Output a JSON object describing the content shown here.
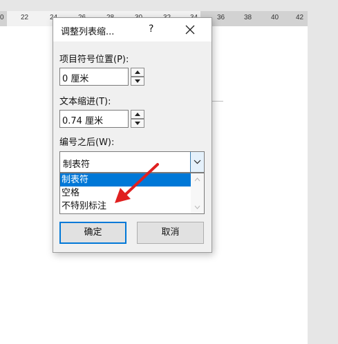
{
  "ruler": {
    "numbers": [
      "0",
      "22",
      "24",
      "26",
      "28",
      "30",
      "32",
      "34",
      "36",
      "38",
      "40",
      "42"
    ]
  },
  "dialog": {
    "title": "调整列表缩...",
    "help_label": "?",
    "position_label": "项目符号位置(P):",
    "position_value": "0 厘米",
    "indent_label": "文本缩进(T):",
    "indent_value": "0.74 厘米",
    "follow_label": "编号之后(W):",
    "follow_value": "制表符",
    "options": [
      "制表符",
      "空格",
      "不特别标注"
    ],
    "selected_index": 0,
    "ok_label": "确定",
    "cancel_label": "取消"
  },
  "colors": {
    "selection": "#0078d7",
    "annotation_arrow": "#e02020"
  },
  "icons": {
    "close": "close-icon",
    "spin_up": "triangle-up-icon",
    "spin_down": "triangle-down-icon",
    "dropdown": "chevron-down-icon",
    "annotation": "red-arrow-icon"
  }
}
